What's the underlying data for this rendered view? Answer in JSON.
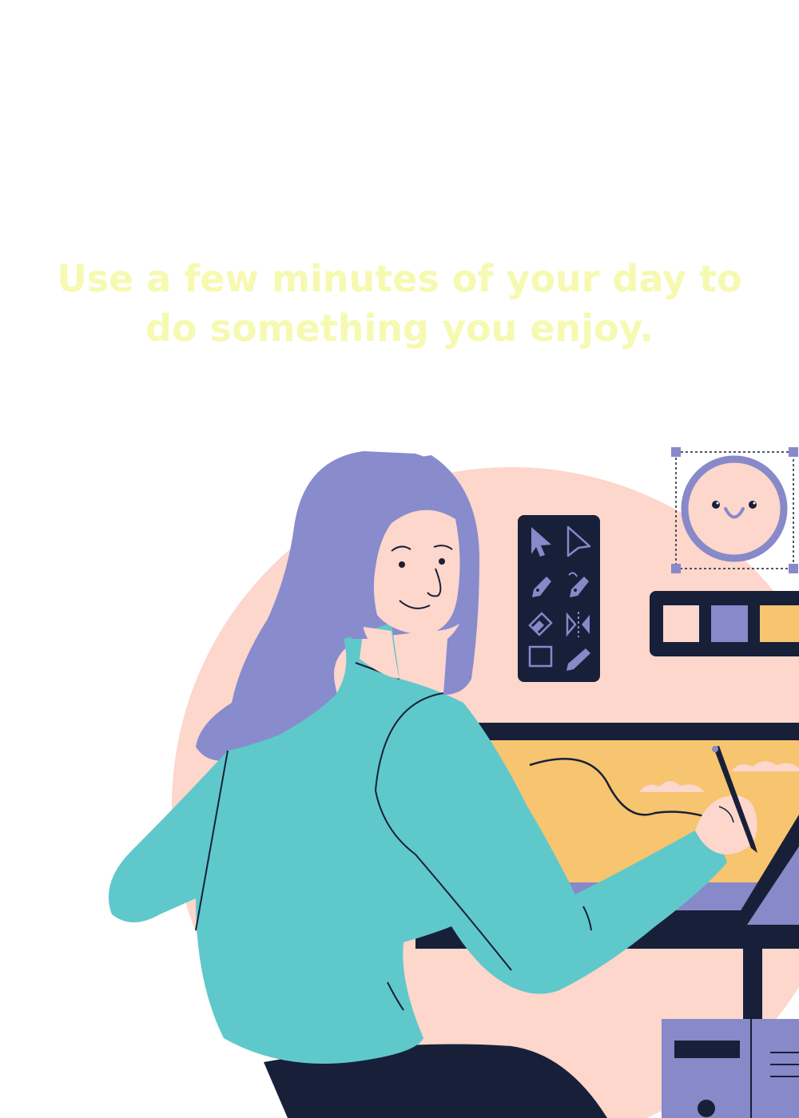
{
  "headline": {
    "line1": "Use a few minutes of your day to",
    "line2": "do something you enjoy."
  },
  "colors": {
    "background": "#ffffff",
    "headline_text": "#f6f9b0",
    "circle_bg": "#fdd6cc",
    "hair": "#888bcc",
    "sweater": "#5fc8cb",
    "skin": "#fdd6cc",
    "navy": "#172038",
    "tablet_yellow": "#f7c46f",
    "lavender": "#8789c9"
  },
  "illustration": {
    "tool_icons": [
      "selection-arrow-icon",
      "direct-selection-icon",
      "pen-tool-icon",
      "anchor-pen-icon",
      "eraser-icon",
      "reflect-icon",
      "rectangle-icon",
      "pencil-icon"
    ],
    "swatches": [
      "#fdd6cc",
      "#8789c9",
      "#f7c46f"
    ]
  }
}
